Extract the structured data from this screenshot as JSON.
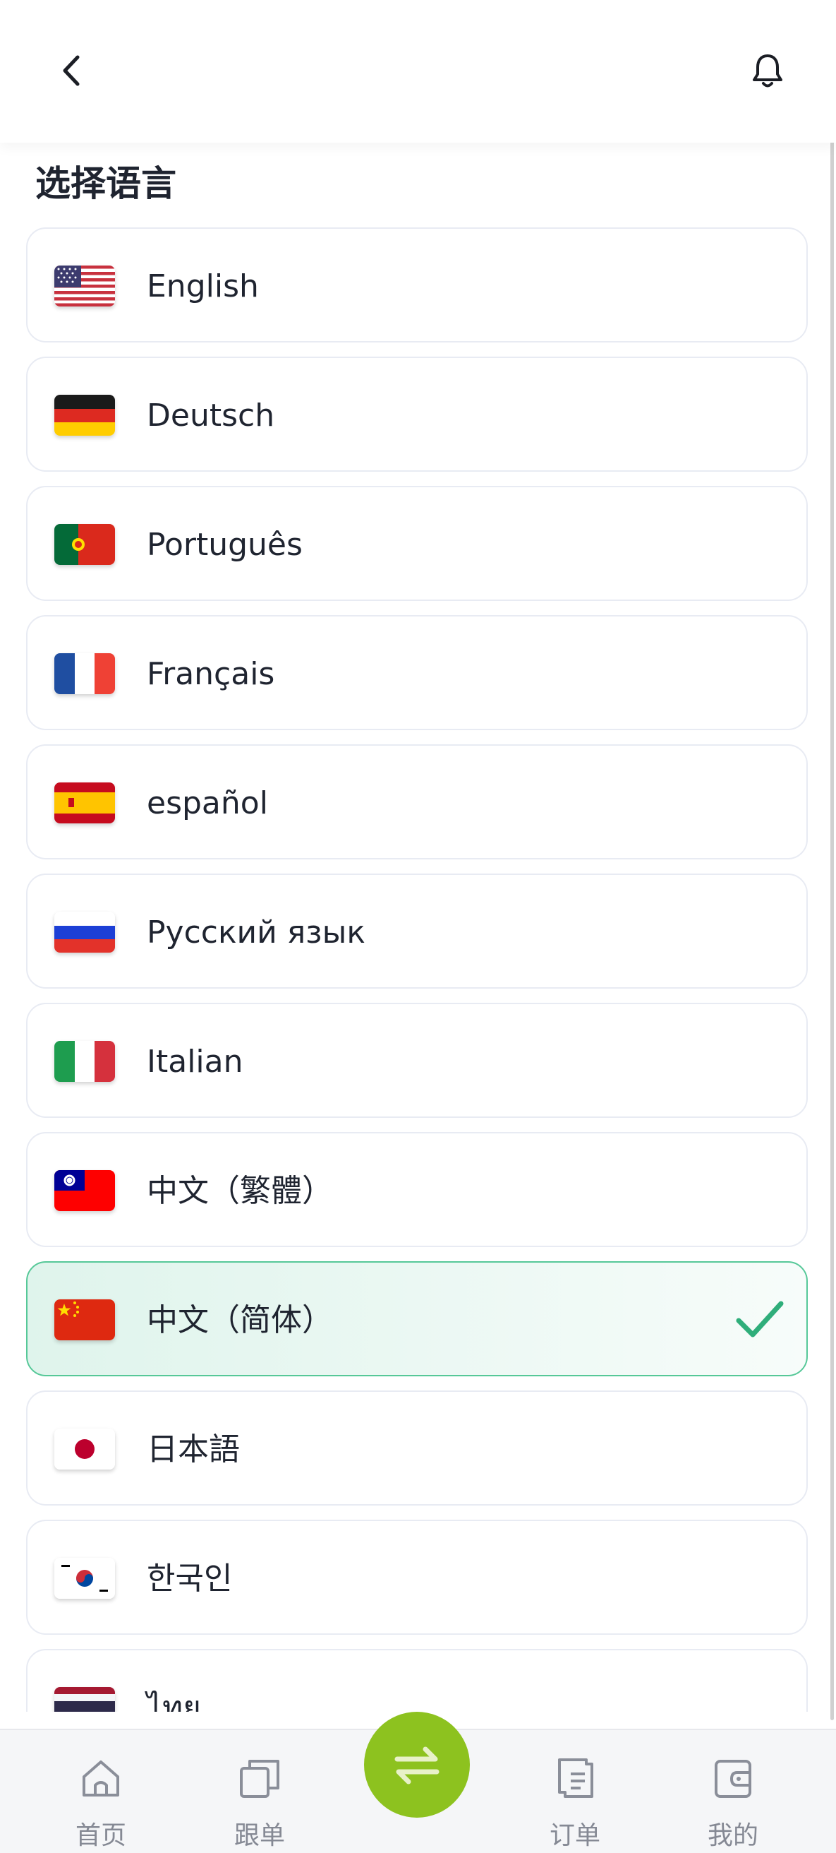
{
  "header": {
    "back_icon": "chevron-left-icon",
    "bell_icon": "bell-icon"
  },
  "page": {
    "title": "选择语言"
  },
  "languages": [
    {
      "label": "English",
      "flag": "us-flag-icon"
    },
    {
      "label": "Deutsch",
      "flag": "de-flag-icon"
    },
    {
      "label": "Português",
      "flag": "pt-flag-icon"
    },
    {
      "label": "Français",
      "flag": "fr-flag-icon"
    },
    {
      "label": "español",
      "flag": "es-flag-icon"
    },
    {
      "label": "Русский язык",
      "flag": "ru-flag-icon"
    },
    {
      "label": "Italian",
      "flag": "it-flag-icon"
    },
    {
      "label": "中文（繁體）",
      "flag": "tw-flag-icon"
    },
    {
      "label": "中文（简体）",
      "flag": "cn-flag-icon",
      "selected": true
    },
    {
      "label": "日本語",
      "flag": "jp-flag-icon"
    },
    {
      "label": "한국인",
      "flag": "kr-flag-icon"
    },
    {
      "label": "ไทย",
      "flag": "th-flag-icon"
    }
  ],
  "tabbar": {
    "home": "首页",
    "follow": "跟单",
    "orders": "订单",
    "mine": "我的",
    "center_icon": "swap-arrows-icon"
  },
  "colors": {
    "accent_green": "#8dc21f",
    "selected_border": "#56c898",
    "check": "#2fae7a"
  }
}
